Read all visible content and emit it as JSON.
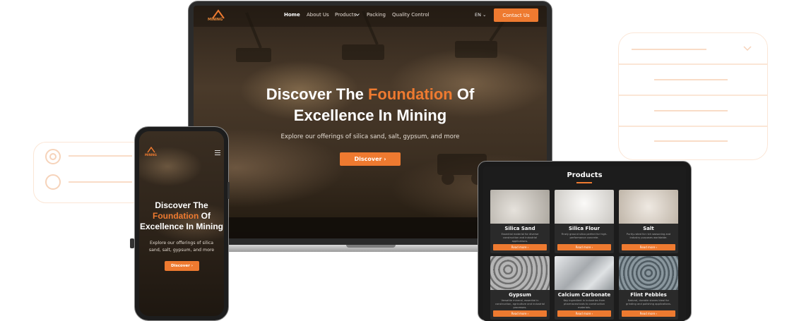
{
  "brand": {
    "logo_text": "MINING",
    "accent": "#ee7a30"
  },
  "desktop": {
    "nav": {
      "links": [
        "Home",
        "About Us",
        "Products",
        "Packing",
        "Quality Control"
      ],
      "language": "EN",
      "contact_label": "Contact Us"
    },
    "hero": {
      "title_part1": "Discover The ",
      "title_accent": "Foundation",
      "title_part2": " Of",
      "title_line2": "Excellence In Mining",
      "subtitle": "Explore our offerings of silica sand, salt, gypsum, and more",
      "cta_label": "Discover"
    }
  },
  "mobile": {
    "logo_text": "MINING",
    "hero": {
      "title_line1": "Discover The",
      "title_accent": "Foundation",
      "title_of": " Of",
      "title_line3": "Excellence In Mining",
      "subtitle": "Explore our offerings of silica sand, salt, gypsum, and more",
      "cta_label": "Discover"
    }
  },
  "tablet": {
    "section_title": "Products",
    "products": [
      {
        "name": "Silica Sand",
        "description": "Essential material for diverse construction and industrial applications.",
        "button": "Read more",
        "color": "#cfcbc4"
      },
      {
        "name": "Silica Flour",
        "description": "Finely ground silica perfect for high-performance concrete.",
        "button": "Read more",
        "color": "#e3e0dc"
      },
      {
        "name": "Salt",
        "description": "Purity-rated for rich seasoning and industry purposes worldwide.",
        "button": "Read more",
        "color": "#d8d1c8"
      },
      {
        "name": "Gypsum",
        "description": "Versatile mineral, essential in construction, agriculture and industrial processes.",
        "button": "Read more",
        "color": "#8e8e8e"
      },
      {
        "name": "Calcium Carbonate",
        "description": "Key ingredient in industries from pharmaceuticals to construction materials.",
        "button": "Read more",
        "color": "#bfc2c4"
      },
      {
        "name": "Flint Pebbles",
        "description": "Natural, durable stones ideal for grinding and polishing applications.",
        "button": "Read more",
        "color": "#6f7a80"
      }
    ]
  }
}
